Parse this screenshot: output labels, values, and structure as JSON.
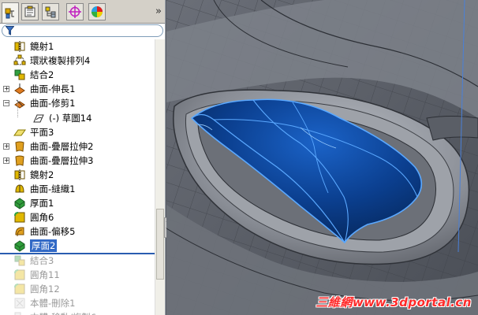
{
  "panel": {
    "tabs": [
      {
        "name": "feature-manager-tab",
        "icon": "feature-tree-icon",
        "active": true
      },
      {
        "name": "property-manager-tab",
        "icon": "property-manager-icon",
        "active": false
      },
      {
        "name": "configuration-manager-tab",
        "icon": "configuration-icon",
        "active": false
      },
      {
        "name": "dimxpert-tab",
        "icon": "crosshair-icon",
        "active": false
      },
      {
        "name": "display-manager-tab",
        "icon": "color-wheel-icon",
        "active": false
      }
    ],
    "more_glyph": "»",
    "filter_icon": "filter-funnel-icon"
  },
  "tree": {
    "items": [
      {
        "label": "鏡射1",
        "icon": "mirror-icon",
        "expandable": false,
        "state": "normal"
      },
      {
        "label": "環狀複製排列4",
        "icon": "circular-pattern-icon",
        "expandable": false,
        "state": "normal"
      },
      {
        "label": "結合2",
        "icon": "combine-icon",
        "expandable": false,
        "state": "normal"
      },
      {
        "label": "曲面-伸長1",
        "icon": "surface-extrude-icon",
        "expandable": true,
        "expanded": false,
        "state": "normal"
      },
      {
        "label": "曲面-修剪1",
        "icon": "surface-trim-icon",
        "expandable": true,
        "expanded": true,
        "state": "normal"
      },
      {
        "label": "(-) 草圖14",
        "icon": "sketch-icon",
        "expandable": false,
        "state": "normal",
        "indent": 1
      },
      {
        "label": "平面3",
        "icon": "plane-icon",
        "expandable": false,
        "state": "normal"
      },
      {
        "label": "曲面-疊層拉伸2",
        "icon": "surface-loft-icon",
        "expandable": true,
        "expanded": false,
        "state": "normal"
      },
      {
        "label": "曲面-疊層拉伸3",
        "icon": "surface-loft-icon",
        "expandable": true,
        "expanded": false,
        "state": "normal"
      },
      {
        "label": "鏡射2",
        "icon": "mirror-icon",
        "expandable": false,
        "state": "normal"
      },
      {
        "label": "曲面-縫織1",
        "icon": "surface-knit-icon",
        "expandable": false,
        "state": "normal"
      },
      {
        "label": "厚面1",
        "icon": "thicken-icon",
        "expandable": false,
        "state": "normal"
      },
      {
        "label": "圓角6",
        "icon": "fillet-icon",
        "expandable": false,
        "state": "normal"
      },
      {
        "label": "曲面-偏移5",
        "icon": "surface-offset-icon",
        "expandable": false,
        "state": "normal"
      },
      {
        "label": "厚面2",
        "icon": "thicken-icon",
        "expandable": false,
        "state": "selected"
      },
      {
        "label": "結合3",
        "icon": "combine-icon",
        "expandable": false,
        "state": "suppressed"
      },
      {
        "label": "圓角11",
        "icon": "fillet-icon",
        "expandable": false,
        "state": "suppressed"
      },
      {
        "label": "圓角12",
        "icon": "fillet-icon",
        "expandable": false,
        "state": "suppressed"
      },
      {
        "label": "本體-刪除1",
        "icon": "delete-body-icon",
        "expandable": false,
        "state": "suppressed"
      },
      {
        "label": "本體-移動/複製6",
        "icon": "move-copy-body-icon",
        "expandable": false,
        "state": "suppressed"
      }
    ]
  },
  "colors": {
    "selection": "#3169c6",
    "surface_blue": "#0b3f8f",
    "edge_highlight": "#5aa8ff",
    "watermark": "#ff2a2a"
  },
  "viewport": {
    "watermark": "三維網www.3dportal.cn"
  }
}
